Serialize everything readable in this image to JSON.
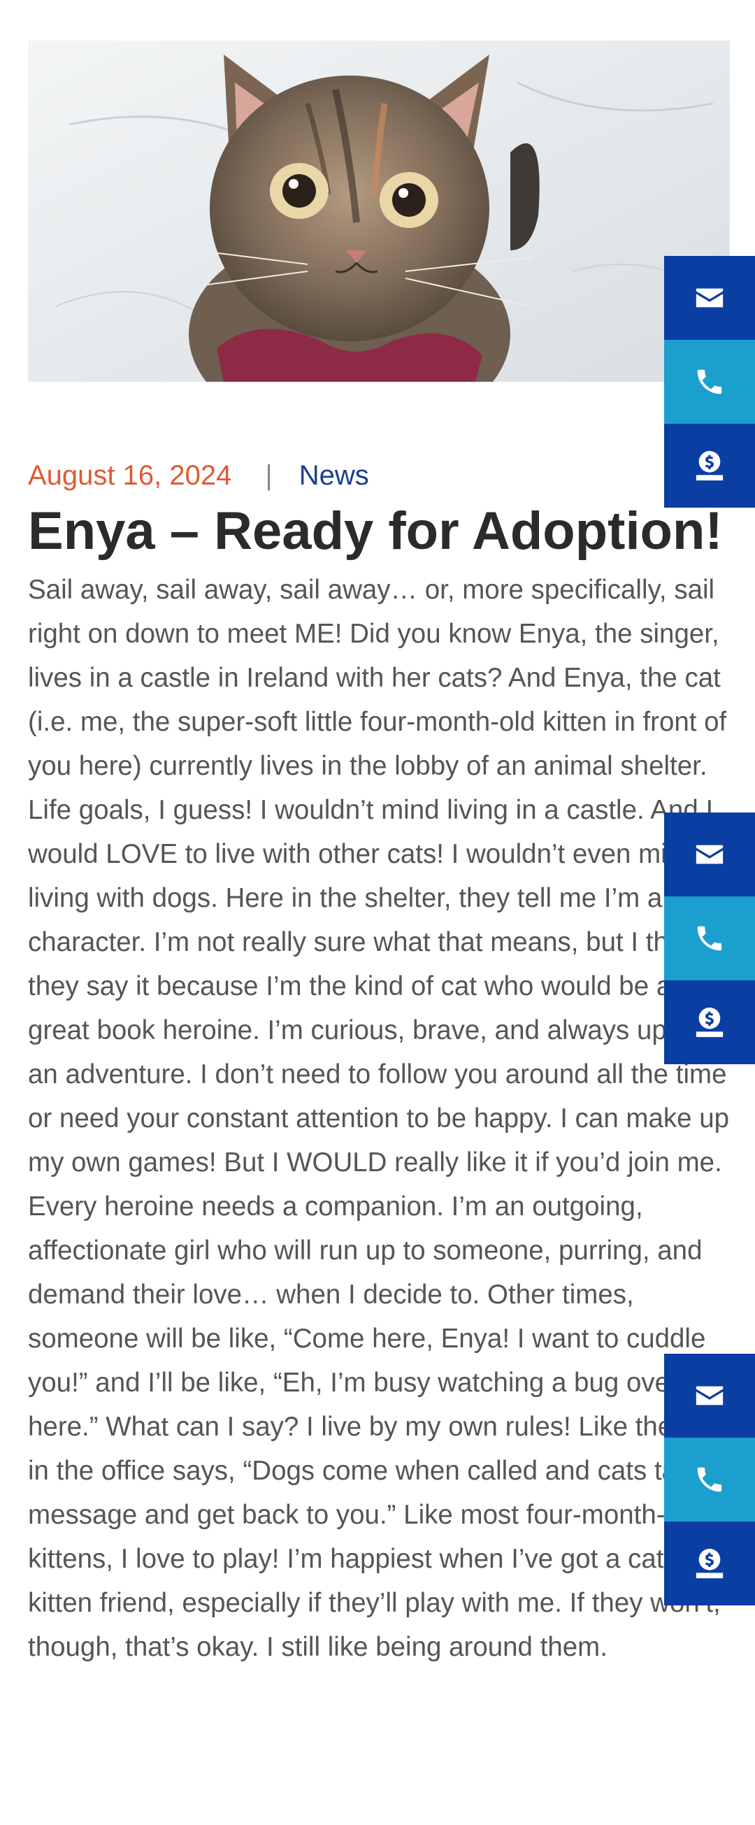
{
  "hero": {
    "image_alt": "Tabby kitten wearing a red bow tie"
  },
  "post": {
    "date": "August 16, 2024",
    "separator": "|",
    "category": "News",
    "title": "Enya – Ready for Adoption!",
    "body": "Sail away, sail away, sail away… or, more specifically, sail right on down to meet ME!  Did you know Enya, the singer, lives in a castle in Ireland with her cats? And Enya, the cat (i.e. me, the super-soft little four-month-old kitten in front of you here) currently lives in the lobby of an animal shelter.  Life goals, I guess! I wouldn’t mind living in a castle. And I would LOVE to live with other cats! I wouldn’t even mind living with dogs.  Here in the shelter, they tell me I’m a character. I’m not really sure what that means, but I think they say it because I’m the kind of cat who would be a great book heroine. I’m curious, brave, and always up for an adventure. I don’t need to follow you around all the time or need your constant attention to be happy. I can make up my own games! But I WOULD really like it if you’d join me. Every heroine needs a companion.  I’m an outgoing, affectionate girl who will run up to someone, purring, and demand their love… when I decide to. Other times, someone will be like, “Come here, Enya! I want to cuddle you!” and I’ll be like, “Eh, I’m busy watching a bug over here.” What can I say? I live by my own rules! Like the sign in the office says, “Dogs come when called and cats take a message and get back to you.”  Like most four-month-old kittens, I love to play! I’m happiest when I’ve got a cat or kitten friend, especially if they’ll play with me. If they won’t, though, that’s okay. I still like being around them."
  },
  "side_actions": [
    {
      "icon": "envelope-icon"
    },
    {
      "icon": "phone-icon"
    },
    {
      "icon": "donate-icon"
    }
  ],
  "colors": {
    "date": "#e05a33",
    "category": "#1c3f94",
    "mail_button": "#0b3ea3",
    "phone_button": "#1b9fcf",
    "donate_button": "#0b3ea3"
  }
}
